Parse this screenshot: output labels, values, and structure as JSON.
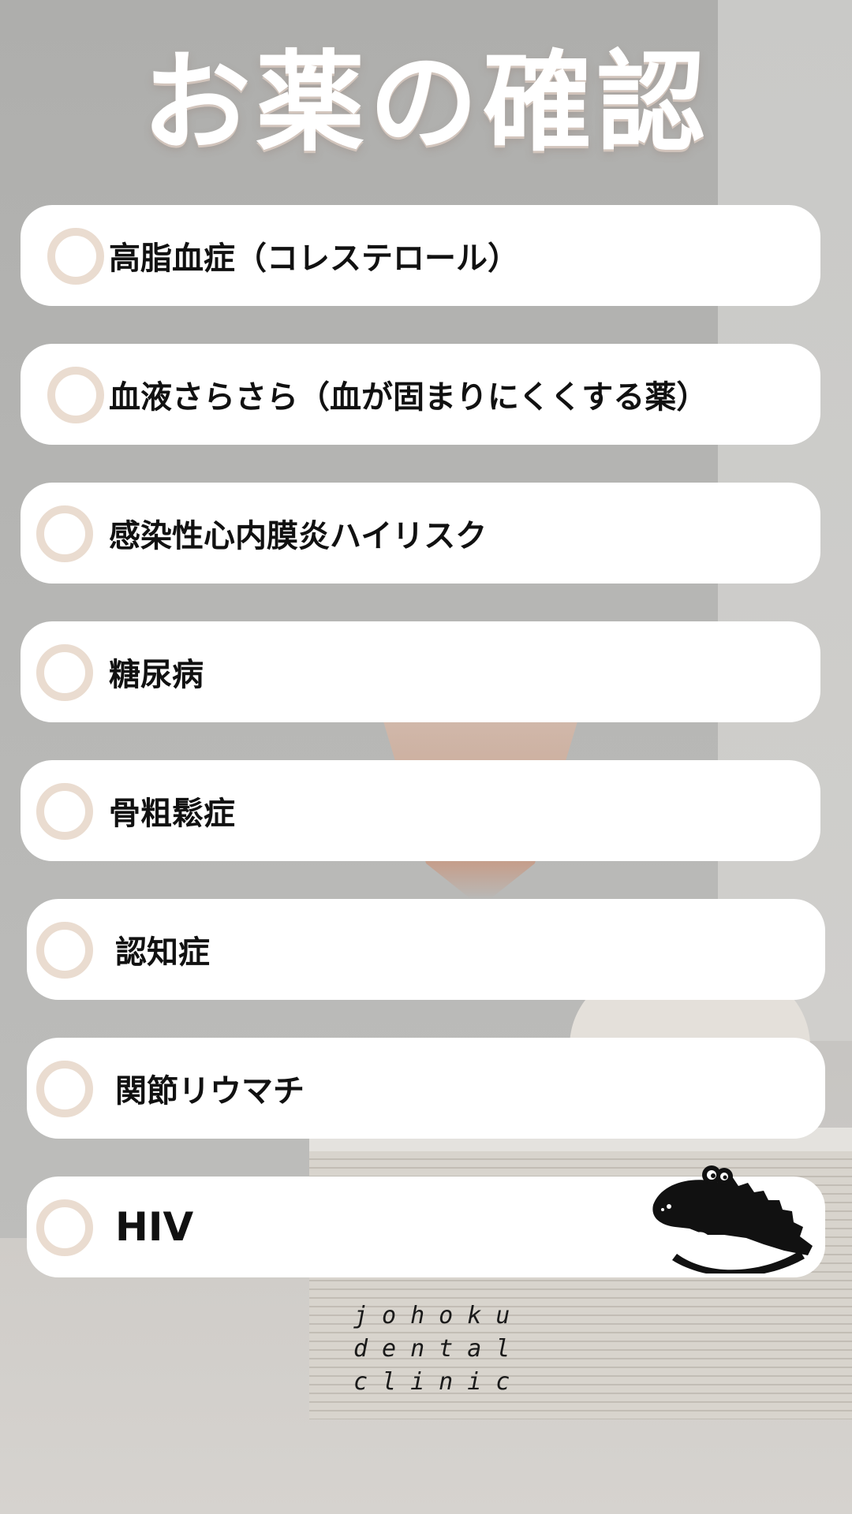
{
  "title": "お薬の確認",
  "items": [
    {
      "label": "高脂血症（コレステロール）"
    },
    {
      "label": "血液さらさら（血が固まりにくくする薬）"
    },
    {
      "label": "感染性心内膜炎ハイリスク"
    },
    {
      "label": "糖尿病"
    },
    {
      "label": "骨粗鬆症"
    },
    {
      "label": "認知症"
    },
    {
      "label": "関節リウマチ"
    },
    {
      "label": "HIV"
    }
  ],
  "logo": {
    "name": "crocodile-logo",
    "lines": [
      "johoku",
      "dental",
      "clinic"
    ]
  },
  "colors": {
    "card": "#ffffff",
    "checkbox_ring": "#eadcd0",
    "title_text": "#ffffff",
    "label_text": "#111111"
  }
}
